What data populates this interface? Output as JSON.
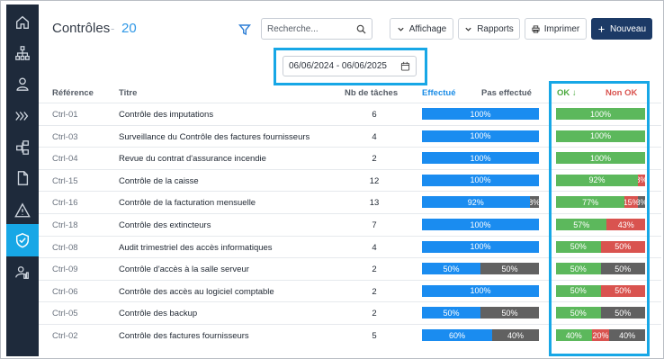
{
  "page": {
    "title": "Contrôles",
    "count": "20"
  },
  "search": {
    "placeholder": "Recherche..."
  },
  "toolbar": {
    "affichage_label": "Affichage",
    "rapports_label": "Rapports",
    "imprimer_label": "Imprimer",
    "nouveau_label": "Nouveau"
  },
  "date_range": "06/06/2024 - 06/06/2025",
  "columns": {
    "reference": "Référence",
    "titre": "Titre",
    "nb_taches": "Nb de tâches",
    "effectue": "Effectué",
    "pas_effectue": "Pas effectué",
    "ok": "OK ↓",
    "non_ok": "Non OK"
  },
  "colors": {
    "done": "#1a8cf0",
    "not_done": "#616161",
    "ok": "#5cb85c",
    "non_ok": "#d9534f",
    "accent": "#17a7e6",
    "sidebar": "#1e2a3b"
  },
  "sidebar": {
    "items": [
      {
        "icon": "home-icon"
      },
      {
        "icon": "org-chart-icon"
      },
      {
        "icon": "user-icon"
      },
      {
        "icon": "process-arrows-icon"
      },
      {
        "icon": "structure-icon"
      },
      {
        "icon": "document-icon"
      },
      {
        "icon": "warning-icon"
      },
      {
        "icon": "shield-check-icon",
        "active": true
      },
      {
        "icon": "user-chart-icon"
      }
    ]
  },
  "rows": [
    {
      "ref": "Ctrl-01",
      "title": "Contrôle des imputations",
      "tasks": "6",
      "done": [
        {
          "pct": 100,
          "label": "100%"
        }
      ],
      "ok": [
        {
          "kind": "ok",
          "pct": 100,
          "label": "100%"
        }
      ]
    },
    {
      "ref": "Ctrl-03",
      "title": "Surveillance du Contrôle des factures fournisseurs",
      "tasks": "4",
      "done": [
        {
          "pct": 100,
          "label": "100%"
        }
      ],
      "ok": [
        {
          "kind": "ok",
          "pct": 100,
          "label": "100%"
        }
      ]
    },
    {
      "ref": "Ctrl-04",
      "title": "Revue du contrat d'assurance incendie",
      "tasks": "2",
      "done": [
        {
          "pct": 100,
          "label": "100%"
        }
      ],
      "ok": [
        {
          "kind": "ok",
          "pct": 100,
          "label": "100%"
        }
      ]
    },
    {
      "ref": "Ctrl-15",
      "title": "Contrôle de la caisse",
      "tasks": "12",
      "done": [
        {
          "pct": 100,
          "label": "100%"
        }
      ],
      "ok": [
        {
          "kind": "ok",
          "pct": 92,
          "label": "92%"
        },
        {
          "kind": "nok",
          "pct": 8,
          "label": "8%"
        }
      ]
    },
    {
      "ref": "Ctrl-16",
      "title": "Contrôle de la facturation mensuelle",
      "tasks": "13",
      "done": [
        {
          "pct": 92,
          "label": "92%"
        },
        {
          "pct": 8,
          "label": "8%",
          "not": true
        }
      ],
      "ok": [
        {
          "kind": "ok",
          "pct": 77,
          "label": "77%"
        },
        {
          "kind": "nok",
          "pct": 15,
          "label": "15%"
        },
        {
          "kind": "nd",
          "pct": 8,
          "label": "8%"
        }
      ]
    },
    {
      "ref": "Ctrl-18",
      "title": "Contrôle des extincteurs",
      "tasks": "7",
      "done": [
        {
          "pct": 100,
          "label": "100%"
        }
      ],
      "ok": [
        {
          "kind": "ok",
          "pct": 57,
          "label": "57%"
        },
        {
          "kind": "nok",
          "pct": 43,
          "label": "43%"
        }
      ]
    },
    {
      "ref": "Ctrl-08",
      "title": "Audit trimestriel des accès informatiques",
      "tasks": "4",
      "done": [
        {
          "pct": 100,
          "label": "100%"
        }
      ],
      "ok": [
        {
          "kind": "ok",
          "pct": 50,
          "label": "50%"
        },
        {
          "kind": "nok",
          "pct": 50,
          "label": "50%"
        }
      ]
    },
    {
      "ref": "Ctrl-09",
      "title": "Contrôle d'accès à la salle serveur",
      "tasks": "2",
      "done": [
        {
          "pct": 50,
          "label": "50%"
        },
        {
          "pct": 50,
          "label": "50%",
          "not": true
        }
      ],
      "ok": [
        {
          "kind": "ok",
          "pct": 50,
          "label": "50%"
        },
        {
          "kind": "nd",
          "pct": 50,
          "label": "50%"
        }
      ]
    },
    {
      "ref": "Ctrl-06",
      "title": "Contrôle des accès au logiciel comptable",
      "tasks": "2",
      "done": [
        {
          "pct": 100,
          "label": "100%"
        }
      ],
      "ok": [
        {
          "kind": "ok",
          "pct": 50,
          "label": "50%"
        },
        {
          "kind": "nok",
          "pct": 50,
          "label": "50%"
        }
      ]
    },
    {
      "ref": "Ctrl-05",
      "title": "Contrôle des backup",
      "tasks": "2",
      "done": [
        {
          "pct": 50,
          "label": "50%"
        },
        {
          "pct": 50,
          "label": "50%",
          "not": true
        }
      ],
      "ok": [
        {
          "kind": "ok",
          "pct": 50,
          "label": "50%"
        },
        {
          "kind": "nd",
          "pct": 50,
          "label": "50%"
        }
      ]
    },
    {
      "ref": "Ctrl-02",
      "title": "Contrôle des factures fournisseurs",
      "tasks": "5",
      "done": [
        {
          "pct": 60,
          "label": "60%"
        },
        {
          "pct": 40,
          "label": "40%",
          "not": true
        }
      ],
      "ok": [
        {
          "kind": "ok",
          "pct": 40,
          "label": "40%"
        },
        {
          "kind": "nok",
          "pct": 20,
          "label": "20%"
        },
        {
          "kind": "nd",
          "pct": 40,
          "label": "40%"
        }
      ]
    }
  ]
}
